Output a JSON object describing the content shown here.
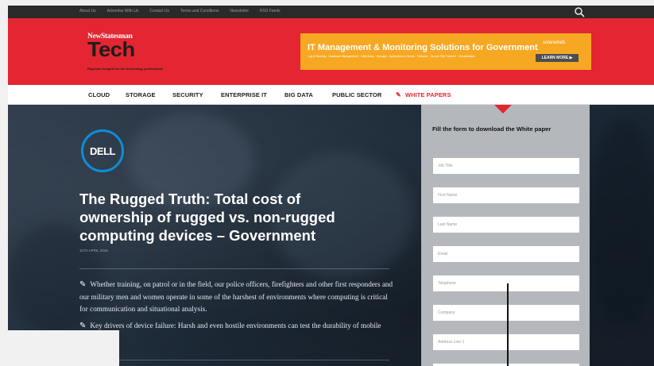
{
  "topbar": {
    "links": [
      "About Us",
      "Advertise With Us",
      "Contact Us",
      "Terms and Conditions",
      "Newsletter",
      "RSS Feeds"
    ],
    "search_icon": "search-icon"
  },
  "header": {
    "brand_top": "NewStatesman",
    "brand_main": "Tech",
    "tagline": "Rigorous insights for the technology professional",
    "ad": {
      "title": "IT Management & Monitoring Solutions for Government",
      "subtitle": "Log & Security · Database Management · Help Desk · Storage · Application & Server · Network · Secure File Transfer · Virtualization",
      "brand": "solarwinds",
      "cta": "LEARN MORE ▶",
      "color": "#f7a823"
    },
    "color": "#e32631"
  },
  "nav": {
    "items": [
      "CLOUD",
      "STORAGE",
      "SECURITY",
      "ENTERPRISE IT",
      "BIG DATA",
      "PUBLIC SECTOR"
    ],
    "white_papers": "WHITE PAPERS",
    "white_papers_icon": "edit-icon"
  },
  "article": {
    "logo_text": "DELL",
    "title": "The Rugged Truth: Total cost of ownership of rugged vs. non-rugged computing devices – Government",
    "date": "11TH APRIL 2016",
    "bullets": [
      "Whether training, on patrol or in the field, our police officers, firefighters and other first responders and our military men and women operate in some of the harshest of environments where computing is critical for communication and situational analysis.",
      "Key drivers of device failure: Harsh and even hostile environments can test the durability of mobile computing"
    ],
    "bullet_icon": "edit-icon"
  },
  "form": {
    "title": "Fill the form to download the White paper",
    "fields": [
      "Job Title",
      "First Name",
      "Last Name",
      "Email",
      "Telephone",
      "Company",
      "Address Line 1",
      ""
    ]
  }
}
